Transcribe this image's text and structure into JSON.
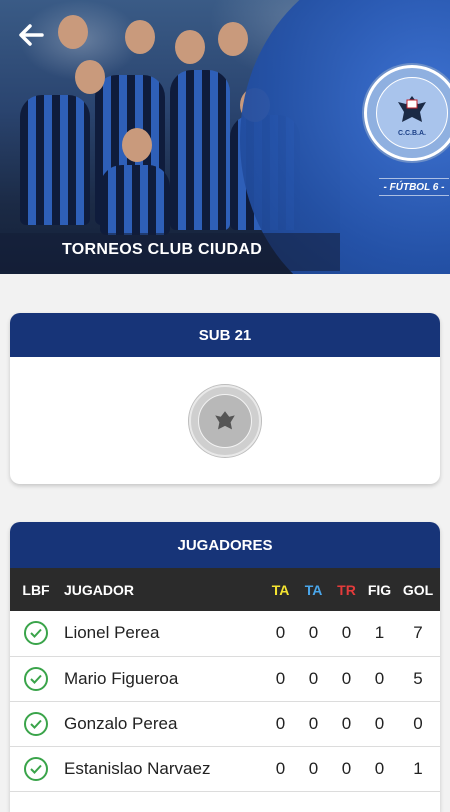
{
  "header": {
    "caption": "TORNEOS CLUB CIUDAD",
    "sport_label": "- FÚTBOL 6 -",
    "crest_text": "TORNEOS CLUB CIUDAD",
    "crest_initials": "C.C.B.A.",
    "crest_footer": "FÚTBOL",
    "back_icon": "arrow-left-icon"
  },
  "category": {
    "title": "SUB 21",
    "logo_text": "TORNEOS CLUB CIUDAD"
  },
  "players": {
    "title": "JUGADORES",
    "columns": {
      "lbf": "LBF",
      "jugador": "JUGADOR",
      "ta_yellow": "TA",
      "ta_blue": "TA",
      "tr": "TR",
      "fig": "FIG",
      "gol": "GOL"
    },
    "column_colors": {
      "ta_yellow": "#f5e431",
      "ta_blue": "#4aa6ea",
      "tr": "#e43b3b"
    },
    "rows": [
      {
        "name": "Lionel Perea",
        "ta_yellow": "0",
        "ta_blue": "0",
        "tr": "0",
        "fig": "1",
        "gol": "7"
      },
      {
        "name": "Mario Figueroa",
        "ta_yellow": "0",
        "ta_blue": "0",
        "tr": "0",
        "fig": "0",
        "gol": "5"
      },
      {
        "name": "Gonzalo Perea",
        "ta_yellow": "0",
        "ta_blue": "0",
        "tr": "0",
        "fig": "0",
        "gol": "0"
      },
      {
        "name": "Estanislao Narvaez",
        "ta_yellow": "0",
        "ta_blue": "0",
        "tr": "0",
        "fig": "0",
        "gol": "1"
      }
    ]
  },
  "colors": {
    "accent": "#173478",
    "check": "#3aa44a",
    "table_header": "#2b2b2b"
  }
}
